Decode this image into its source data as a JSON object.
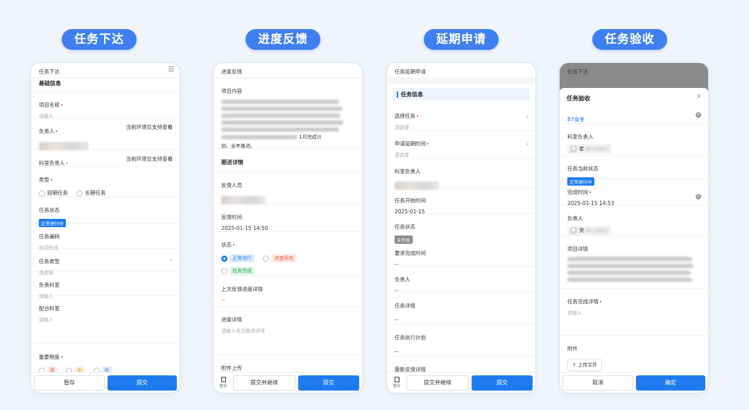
{
  "titles": [
    "任务下达",
    "进度反馈",
    "延期申请",
    "任务验收"
  ],
  "colors": {
    "accent": "#1f7cf0",
    "pill": "#3f7ff0",
    "required": "#e23c3c"
  },
  "p1": {
    "header": "任务下达",
    "section": "基础信息",
    "project_name_label": "项目名称",
    "project_name_ph": "请输入",
    "owner_label": "负责人",
    "owner_note": "当前环境仅支持查看",
    "dept_owner_label": "科室负责人",
    "dept_owner_note": "当前环境仅支持查看",
    "type_label": "类型",
    "type_opt1": "短期任务",
    "type_opt2": "长期任务",
    "status_label": "任务状态",
    "status_value": "正常进行中",
    "code_label": "任务编码",
    "code_ph": "自动生成",
    "task_type_label": "任务类型",
    "task_type_ph": "请选择",
    "dept_label": "负责科室",
    "dept_ph": "请输入",
    "coop_label": "配合科室",
    "coop_ph": "请输入",
    "priority_label": "重要程度",
    "priority_high": "高",
    "priority_mid": "中",
    "priority_low": "低",
    "save_btn": "暂存",
    "submit_btn": "提交"
  },
  "p2": {
    "header": "进度反馈",
    "content_label": "项目内容",
    "content_tail": "划、全年推进。",
    "content_tail2": "1月完成计",
    "section": "跟进详情",
    "reporter_label": "反馈人员",
    "time_label": "反馈时间",
    "time_value": "2025-01-15 14:50",
    "state_label": "状态",
    "state_normal": "正常进行",
    "state_risk": "进度风险",
    "state_done": "任务完成",
    "last_label": "上次反馈进度详情",
    "last_value": "--",
    "detail_label": "进度详情",
    "detail_ph": "请输入本次跟进详情",
    "attach_label": "附件上传",
    "draft_label": "暂存",
    "continue_btn": "提交并继续",
    "submit_btn": "提交"
  },
  "p3": {
    "header": "任务延期申请",
    "section": "任务信息",
    "select_label": "选择任务",
    "select_ph": "请选择",
    "time_label": "申请延期时间",
    "time_ph": "请选择",
    "dept_owner_label": "科室负责人",
    "start_label": "任务开始时间",
    "start_value": "2025-01-15",
    "status_label": "任务状态",
    "status_value": "未开始",
    "req_time_label": "要求完成时间",
    "req_time_value": "--",
    "owner_label": "负责人",
    "owner_value": "--",
    "detail_label": "任务详情",
    "detail_value": "--",
    "plan_label": "任务执行计划",
    "plan_value": "--",
    "latest_label": "最新反馈详情",
    "draft_label": "暂存",
    "continue_btn": "提交并继续",
    "submit_btn": "提交"
  },
  "p4": {
    "header": "任务下达",
    "modal_title": "任务验收",
    "close": "×",
    "task_value": "B7食堂",
    "dept_owner_label": "科室负责人",
    "dept_owner_name": "崔",
    "status_label": "任务当前状态",
    "status_value": "正常进行中",
    "done_time_label": "完成时间",
    "done_time_value": "2025-01-15 14:53",
    "owner_label": "负责人",
    "owner_name": "贺",
    "detail_label": "项目详情",
    "complete_label": "任务完成详情",
    "complete_ph": "请输入",
    "attach_label": "附件",
    "upload_btn": "上传文件",
    "cancel_btn": "取消",
    "confirm_btn": "确定"
  }
}
